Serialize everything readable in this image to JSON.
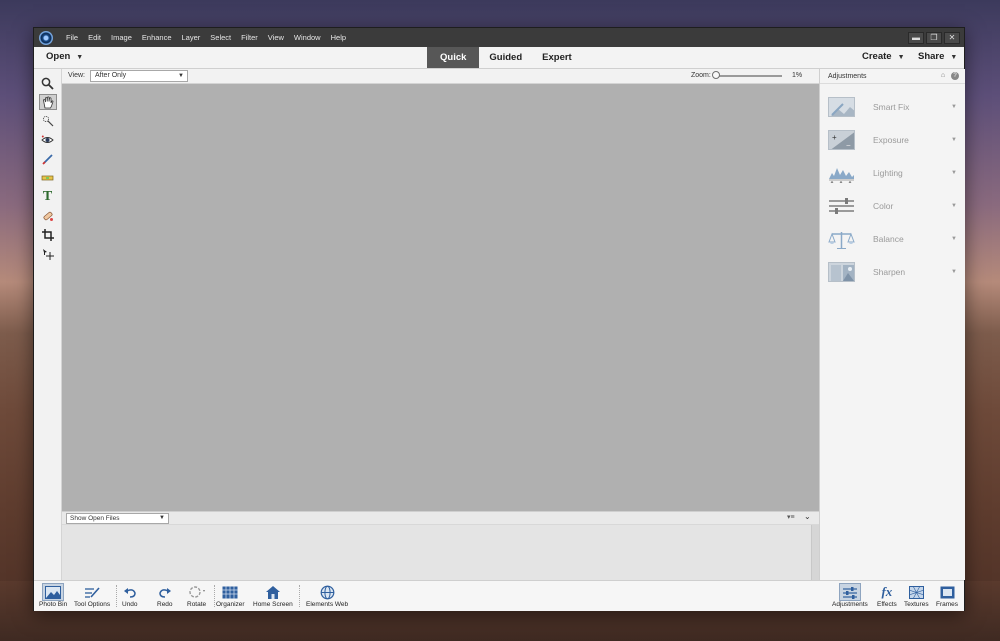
{
  "menu": {
    "items": [
      "File",
      "Edit",
      "Image",
      "Enhance",
      "Layer",
      "Select",
      "Filter",
      "View",
      "Window",
      "Help"
    ]
  },
  "window_controls": {
    "minimize": "▬",
    "restore": "❐",
    "close": "✕"
  },
  "topbar": {
    "open_label": "Open",
    "modes": [
      {
        "label": "Quick",
        "active": true
      },
      {
        "label": "Guided",
        "active": false
      },
      {
        "label": "Expert",
        "active": false
      }
    ],
    "create_label": "Create",
    "share_label": "Share"
  },
  "options": {
    "view_label": "View:",
    "view_value": "After Only",
    "zoom_label": "Zoom:",
    "zoom_value": "1%"
  },
  "tools": [
    {
      "name": "zoom-tool",
      "icon": "magnifier-icon"
    },
    {
      "name": "hand-tool",
      "icon": "hand-icon"
    },
    {
      "name": "quick-selection-tool",
      "icon": "selection-icon"
    },
    {
      "name": "red-eye-tool",
      "icon": "eye-icon"
    },
    {
      "name": "whiten-teeth-tool",
      "icon": "brush-icon"
    },
    {
      "name": "straighten-tool",
      "icon": "level-icon"
    },
    {
      "name": "type-tool",
      "icon": "type-icon"
    },
    {
      "name": "spot-healing-tool",
      "icon": "bandage-icon"
    },
    {
      "name": "crop-tool",
      "icon": "crop-icon"
    },
    {
      "name": "move-tool",
      "icon": "move-icon"
    }
  ],
  "bin": {
    "select_value": "Show Open Files"
  },
  "panel": {
    "title": "Adjustments",
    "items": [
      {
        "label": "Smart Fix",
        "icon": "smart-fix-icon"
      },
      {
        "label": "Exposure",
        "icon": "exposure-icon"
      },
      {
        "label": "Lighting",
        "icon": "lighting-icon"
      },
      {
        "label": "Color",
        "icon": "color-icon"
      },
      {
        "label": "Balance",
        "icon": "balance-icon"
      },
      {
        "label": "Sharpen",
        "icon": "sharpen-icon"
      }
    ]
  },
  "taskbar": {
    "photo_bin": "Photo Bin",
    "tool_options": "Tool Options",
    "undo": "Undo",
    "redo": "Redo",
    "rotate": "Rotate",
    "organizer": "Organizer",
    "home_screen": "Home Screen",
    "elements_web": "Elements Web",
    "adjustments": "Adjustments",
    "effects": "Effects",
    "textures": "Textures",
    "frames": "Frames"
  }
}
